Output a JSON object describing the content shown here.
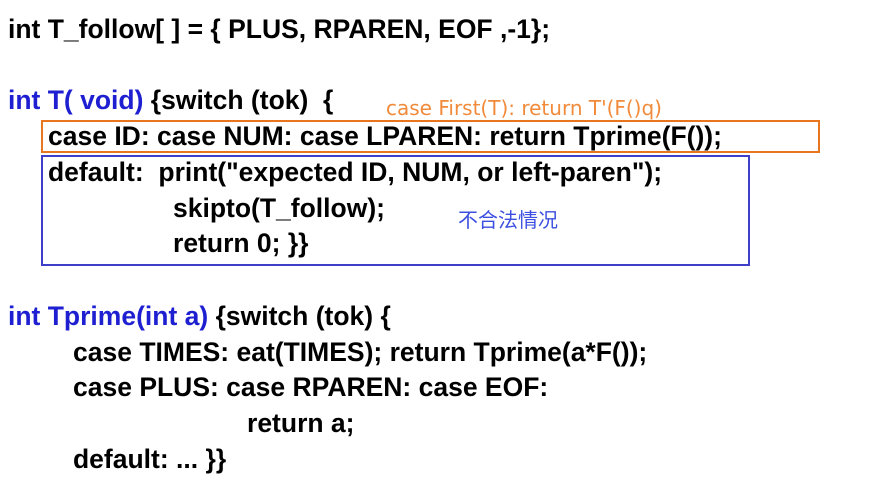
{
  "colors": {
    "keyword_blue": "#1f1fd2",
    "annotation_orange": "#f18b3b",
    "annotation_blue": "#3b4fe0",
    "box_orange": "#e8761e",
    "box_blue": "#3e3ec9"
  },
  "code": {
    "follow_decl": "int T_follow[ ] = { PLUS, RPAREN, EOF ,-1};",
    "t_sig_kw": "int T( void)",
    "t_sig_rest": " {switch (tok)  {",
    "t_case_line": "case ID: case NUM: case LPAREN: return Tprime(F());",
    "t_default_line": "default:  print(\"expected ID, NUM, or left-paren\");",
    "t_skipto_line": "skipto(T_follow);",
    "t_return_line": "return 0; }}",
    "tprime_sig_kw": "int Tprime(int a)",
    "tprime_sig_rest": " {switch (tok) {",
    "tprime_times_line": "case TIMES: eat(TIMES); return Tprime(a*F());",
    "tprime_plus_line": "case PLUS: case RPAREN: case EOF:",
    "tprime_return_line": "return a;",
    "tprime_default_line": "default: ... }}"
  },
  "annotations": {
    "first_set_note": "case First(T): return T'(F()q)",
    "invalid_note": "不合法情况"
  }
}
